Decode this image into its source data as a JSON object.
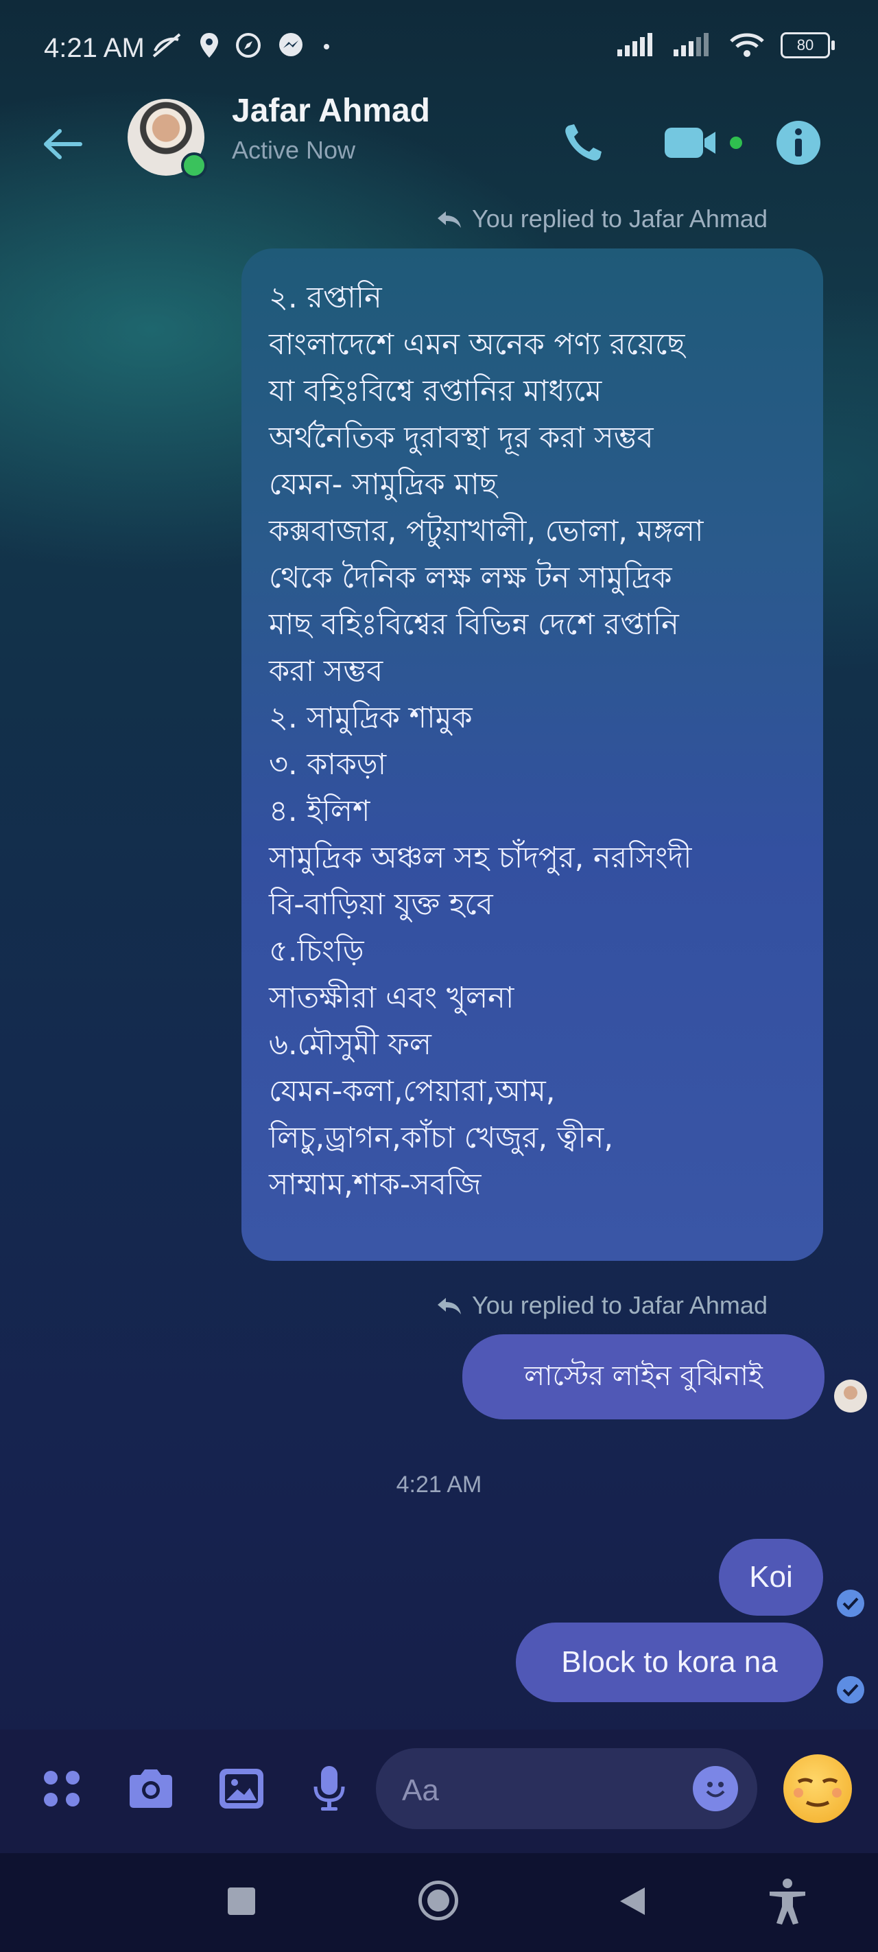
{
  "status_bar": {
    "time": "4:21 AM",
    "battery": "80",
    "icons_left": [
      "call-muted-icon",
      "location-icon",
      "compass-icon",
      "messenger-icon",
      "dot-icon"
    ],
    "icons_right": [
      "signal-icon",
      "signal-icon-2",
      "wifi-icon",
      "battery-icon"
    ]
  },
  "header": {
    "contact_name": "Jafar Ahmad",
    "contact_status": "Active Now",
    "actions": [
      "phone-icon",
      "video-call-icon",
      "info-icon"
    ]
  },
  "messages": [
    {
      "reply_label": "You replied to Jafar Ahmad",
      "lines": [
        "২. রপ্তানি",
        "বাংলাদেশে এমন অনেক পণ্য রয়েছে",
        "যা বহিঃবিশ্বে রপ্তানির মাধ্যমে",
        "অর্থনৈতিক দুরাবস্থা দূর করা সম্ভব",
        "যেমন- সামুদ্রিক মাছ",
        "কক্সবাজার, পটুয়াখালী, ভোলা, মঙ্গলা",
        "থেকে দৈনিক লক্ষ লক্ষ টন সামুদ্রিক",
        "মাছ বহিঃবিশ্বের বিভিন্ন দেশে রপ্তানি",
        "করা সম্ভব",
        "২. সামুদ্রিক শামুক",
        "৩. কাকড়া",
        "৪. ইলিশ",
        "সামুদ্রিক অঞ্চল সহ চাঁদপুর, নরসিংদী",
        "বি-বাড়িয়া যুক্ত হবে",
        "৫.চিংড়ি",
        "সাতক্ষীরা এবং খুলনা",
        "৬.মৌসুমী ফল",
        "যেমন-কলা,পেয়ারা,আম,",
        "লিচু,ড্রাগন,কাঁচা খেজুর, ত্বীন,",
        "সাম্মাম,শাক-সবজি"
      ]
    },
    {
      "reply_label": "You replied to Jafar Ahmad",
      "text": "লাস্টের লাইন বুঝিনাই"
    }
  ],
  "timestamp": "4:21 AM",
  "recent": [
    {
      "text": "Koi"
    },
    {
      "text": "Block to kora na"
    }
  ],
  "composer": {
    "placeholder": "Aa",
    "buttons": [
      "apps-icon",
      "camera-icon",
      "gallery-icon",
      "microphone-icon",
      "emoji-icon",
      "reaction-emoji-icon"
    ]
  },
  "colors": {
    "bubble": "#5058b6",
    "accent": "#74c7e0",
    "active": "#3ac25c"
  }
}
